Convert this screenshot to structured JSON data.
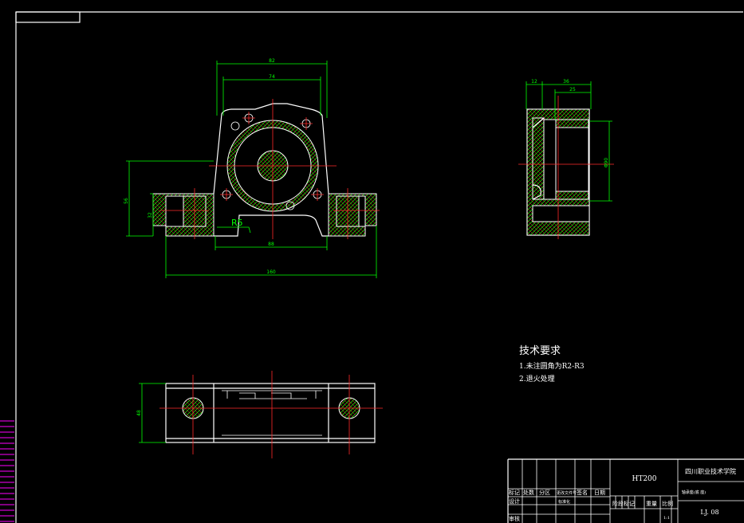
{
  "front_view": {
    "dim_top_outer": "82",
    "dim_top_inner": "74",
    "dim_height_total": "56",
    "dim_height_base": "32",
    "radius_label": "R5",
    "dim_bolt_spacing": "88",
    "dim_base_length": "160"
  },
  "side_view": {
    "dim_a": "12",
    "dim_b": "36",
    "dim_c": "25",
    "dim_bore": "Φ90"
  },
  "top_view": {
    "dim_width": "48"
  },
  "tech_requirements": {
    "heading": "技术要求",
    "items": [
      "1.未注圆角为R2-R3",
      "2.退火处理"
    ]
  },
  "title_block": {
    "material": "HT200",
    "school": "四川职业技术学院",
    "part_name": "轴承座(底 座)",
    "drawing_no": "LJ. 08",
    "labels": {
      "mark": "标记",
      "count": "处数",
      "zone": "分区",
      "change_doc": "更改文件号",
      "signature": "签名",
      "date": "日期",
      "design": "设计",
      "standardize": "标准化",
      "stage_mark": "阶段标记",
      "weight": "重量",
      "scale": "比例",
      "review": "审核",
      "scale_value": "1:1"
    }
  }
}
